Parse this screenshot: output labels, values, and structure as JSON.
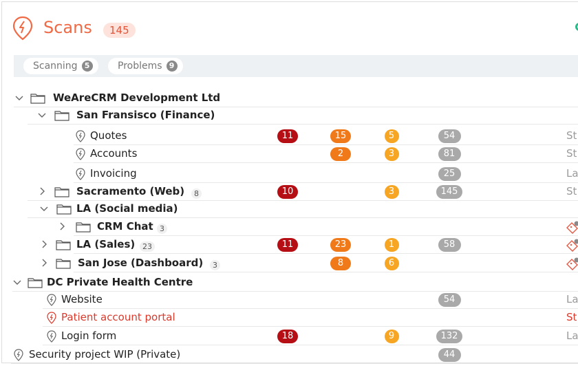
{
  "header": {
    "title": "Scans",
    "count": "145"
  },
  "filters": [
    {
      "label": "Scanning",
      "count": "5"
    },
    {
      "label": "Problems",
      "count": "9"
    }
  ],
  "rows": [
    {
      "label": "WeAreCRM Development Ltd",
      "bold": true,
      "chevron": "down",
      "icon": "folder-icon"
    },
    {
      "label": "San Fransisco (Finance)",
      "bold": true,
      "chevron": "down",
      "icon": "folder-icon"
    },
    {
      "label": "Quotes",
      "icon": "scan-icon",
      "b1": "11",
      "b2": "15",
      "b3": "5",
      "b4": "54",
      "trail": "St"
    },
    {
      "label": "Accounts",
      "icon": "scan-icon",
      "b2": "2",
      "b3": "3",
      "b4": "81",
      "trail": "St"
    },
    {
      "label": "Invoicing",
      "icon": "scan-icon",
      "b4": "25",
      "trail": "La"
    },
    {
      "label": "Sacramento (Web)",
      "bold": true,
      "chevron": "right",
      "icon": "folder-icon",
      "sub": "8",
      "b1": "10",
      "b3": "3",
      "b4": "145",
      "trail": "St"
    },
    {
      "label": "LA (Social media)",
      "bold": true,
      "chevron": "down",
      "icon": "folder-icon"
    },
    {
      "label": "CRM Chat",
      "bold": true,
      "chevron": "right",
      "icon": "folder-icon",
      "sub": "3",
      "ticket": true
    },
    {
      "label": "LA (Sales)",
      "bold": true,
      "chevron": "right",
      "icon": "folder-icon",
      "sub": "23",
      "b1": "11",
      "b2": "23",
      "b3": "1",
      "b4": "58",
      "ticket": true
    },
    {
      "label": "San Jose (Dashboard)",
      "bold": true,
      "chevron": "right",
      "icon": "folder-icon",
      "sub": "3",
      "b2": "8",
      "b3": "6",
      "ticket": true
    },
    {
      "label": "DC Private Health Centre",
      "bold": true,
      "chevron": "down",
      "icon": "folder-icon"
    },
    {
      "label": "Website",
      "icon": "scan-icon",
      "b4": "54",
      "trail": "La"
    },
    {
      "label": "Patient account portal",
      "red": true,
      "icon": "scan-icon-red",
      "trail": "St",
      "trail_red": true
    },
    {
      "label": "Login form",
      "icon": "scan-icon",
      "b1": "18",
      "b3": "9",
      "b4": "132",
      "trail": "La"
    },
    {
      "label": "Security project WIP (Private)",
      "icon": "scan-icon",
      "b4": "44"
    }
  ]
}
